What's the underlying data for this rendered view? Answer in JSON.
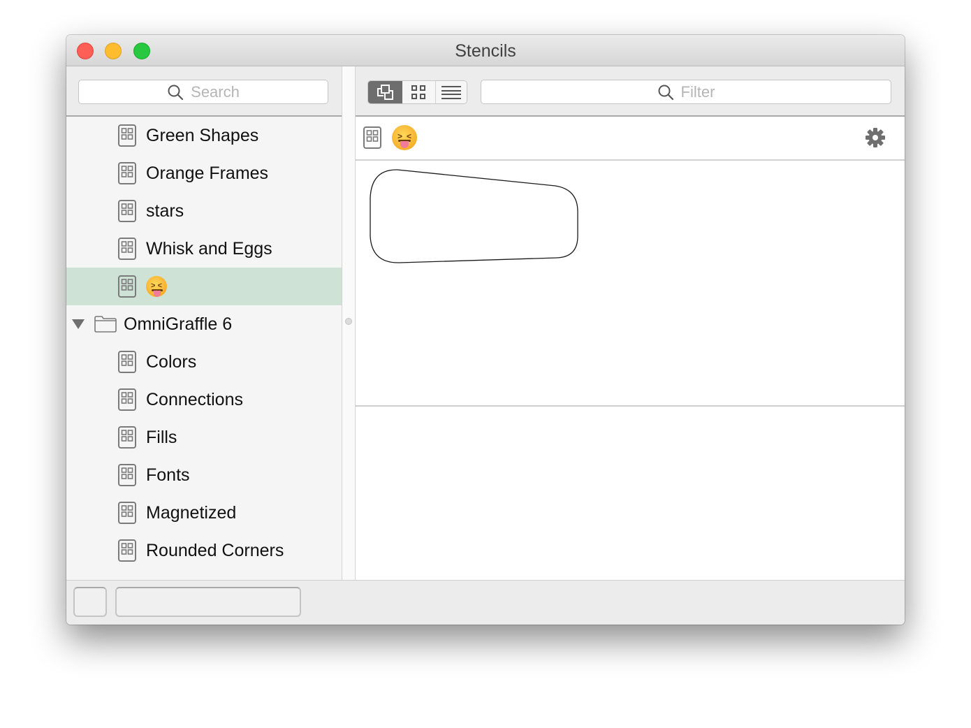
{
  "window": {
    "title": "Stencils",
    "controls": [
      "close",
      "minimize",
      "zoom"
    ]
  },
  "sidebar": {
    "search": {
      "placeholder": "Search",
      "value": "",
      "icon": "search-icon"
    },
    "items": [
      {
        "type": "stencil",
        "label": "Green Shapes",
        "icon": "stencil-grid-icon",
        "selected": false
      },
      {
        "type": "stencil",
        "label": "Orange Frames",
        "icon": "stencil-grid-icon",
        "selected": false
      },
      {
        "type": "stencil",
        "label": "stars",
        "icon": "stencil-grid-icon",
        "selected": false
      },
      {
        "type": "stencil",
        "label": "Whisk and Eggs",
        "icon": "stencil-grid-icon",
        "selected": false
      },
      {
        "type": "stencil",
        "label": "😝",
        "icon": "stencil-grid-icon",
        "selected": true
      },
      {
        "type": "folder",
        "label": "OmniGraffle 6",
        "icon": "folder-icon",
        "expanded": true
      },
      {
        "type": "stencil",
        "label": "Colors",
        "icon": "stencil-grid-icon",
        "selected": false
      },
      {
        "type": "stencil",
        "label": "Connections",
        "icon": "stencil-grid-icon",
        "selected": false
      },
      {
        "type": "stencil",
        "label": "Fills",
        "icon": "stencil-grid-icon",
        "selected": false
      },
      {
        "type": "stencil",
        "label": "Fonts",
        "icon": "stencil-grid-icon",
        "selected": false
      },
      {
        "type": "stencil",
        "label": "Magnetized",
        "icon": "stencil-grid-icon",
        "selected": false
      },
      {
        "type": "stencil",
        "label": "Rounded Corners",
        "icon": "stencil-grid-icon",
        "selected": false
      }
    ],
    "selected_color": "#cfe2d6"
  },
  "toolbar": {
    "view_modes": [
      {
        "name": "shapes-view",
        "icon": "shapes-view-icon",
        "active": true
      },
      {
        "name": "grid-view",
        "icon": "grid-view-icon",
        "active": false
      },
      {
        "name": "list-view",
        "icon": "list-view-icon",
        "active": false
      }
    ],
    "filter": {
      "placeholder": "Filter",
      "value": "",
      "icon": "search-icon"
    }
  },
  "stencil_header": {
    "name": "😝",
    "icon": "stencil-grid-icon",
    "settings_icon": "gear-icon"
  },
  "canvas": {
    "shapes": [
      {
        "kind": "rounded-trapezoid",
        "stroke": "#000000",
        "fill": "#ffffff"
      }
    ]
  },
  "bottom_bar": {
    "button_label": "",
    "name_field_value": ""
  }
}
